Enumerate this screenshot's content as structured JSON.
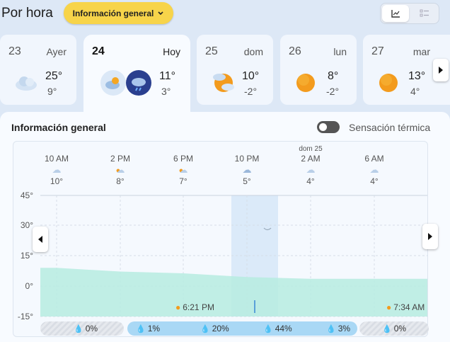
{
  "header": {
    "title": "Por hora",
    "dropdown_label": "Información general"
  },
  "days": [
    {
      "day": "23",
      "label": "Ayer",
      "high": "25°",
      "low": "9°",
      "icon": "cloudy-icon"
    },
    {
      "day": "24",
      "label": "Hoy",
      "high": "11°",
      "low": "3°",
      "icon": "partly-cloudy-night-rain-icon"
    },
    {
      "day": "25",
      "label": "dom",
      "high": "10°",
      "low": "-2°",
      "icon": "partly-sunny-icon"
    },
    {
      "day": "26",
      "label": "lun",
      "high": "8°",
      "low": "-2°",
      "icon": "sunny-icon"
    },
    {
      "day": "27",
      "label": "mar",
      "high": "13°",
      "low": "4°",
      "icon": "sunny-icon"
    }
  ],
  "panel": {
    "title": "Información general",
    "feels_like_label": "Sensación térmica"
  },
  "hours": [
    {
      "time": "10 AM",
      "date": "",
      "temp": "10°",
      "icon": "cloud-icon"
    },
    {
      "time": "2 PM",
      "date": "",
      "temp": "8°",
      "icon": "partly-sunny-icon"
    },
    {
      "time": "6 PM",
      "date": "",
      "temp": "7°",
      "icon": "partly-sunny-icon"
    },
    {
      "time": "10 PM",
      "date": "",
      "temp": "5°",
      "icon": "cloud-rain-icon"
    },
    {
      "time": "2 AM",
      "date": "dom 25",
      "temp": "4°",
      "icon": "cloud-icon"
    },
    {
      "time": "6 AM",
      "date": "",
      "temp": "4°",
      "icon": "cloud-icon"
    }
  ],
  "y_axis": [
    "45°",
    "30°",
    "15°",
    "0°",
    "-15°"
  ],
  "sun_events": {
    "sunset": "6:21 PM",
    "sunrise": "7:34 AM"
  },
  "precipitation": [
    "0%",
    "1%",
    "20%",
    "44%",
    "3%",
    "0%"
  ],
  "chart_data": {
    "type": "area",
    "ylim": [
      -15,
      45
    ],
    "x": [
      "10 AM",
      "2 PM",
      "6 PM",
      "10 PM",
      "2 AM",
      "6 AM"
    ],
    "series": [
      {
        "values": [
          10,
          8,
          7,
          5,
          4,
          4
        ]
      }
    ]
  },
  "colors": {
    "accent": "#f7d44a",
    "precip_bar": "#a9d8f5",
    "temp_area": "#b6ece0"
  }
}
